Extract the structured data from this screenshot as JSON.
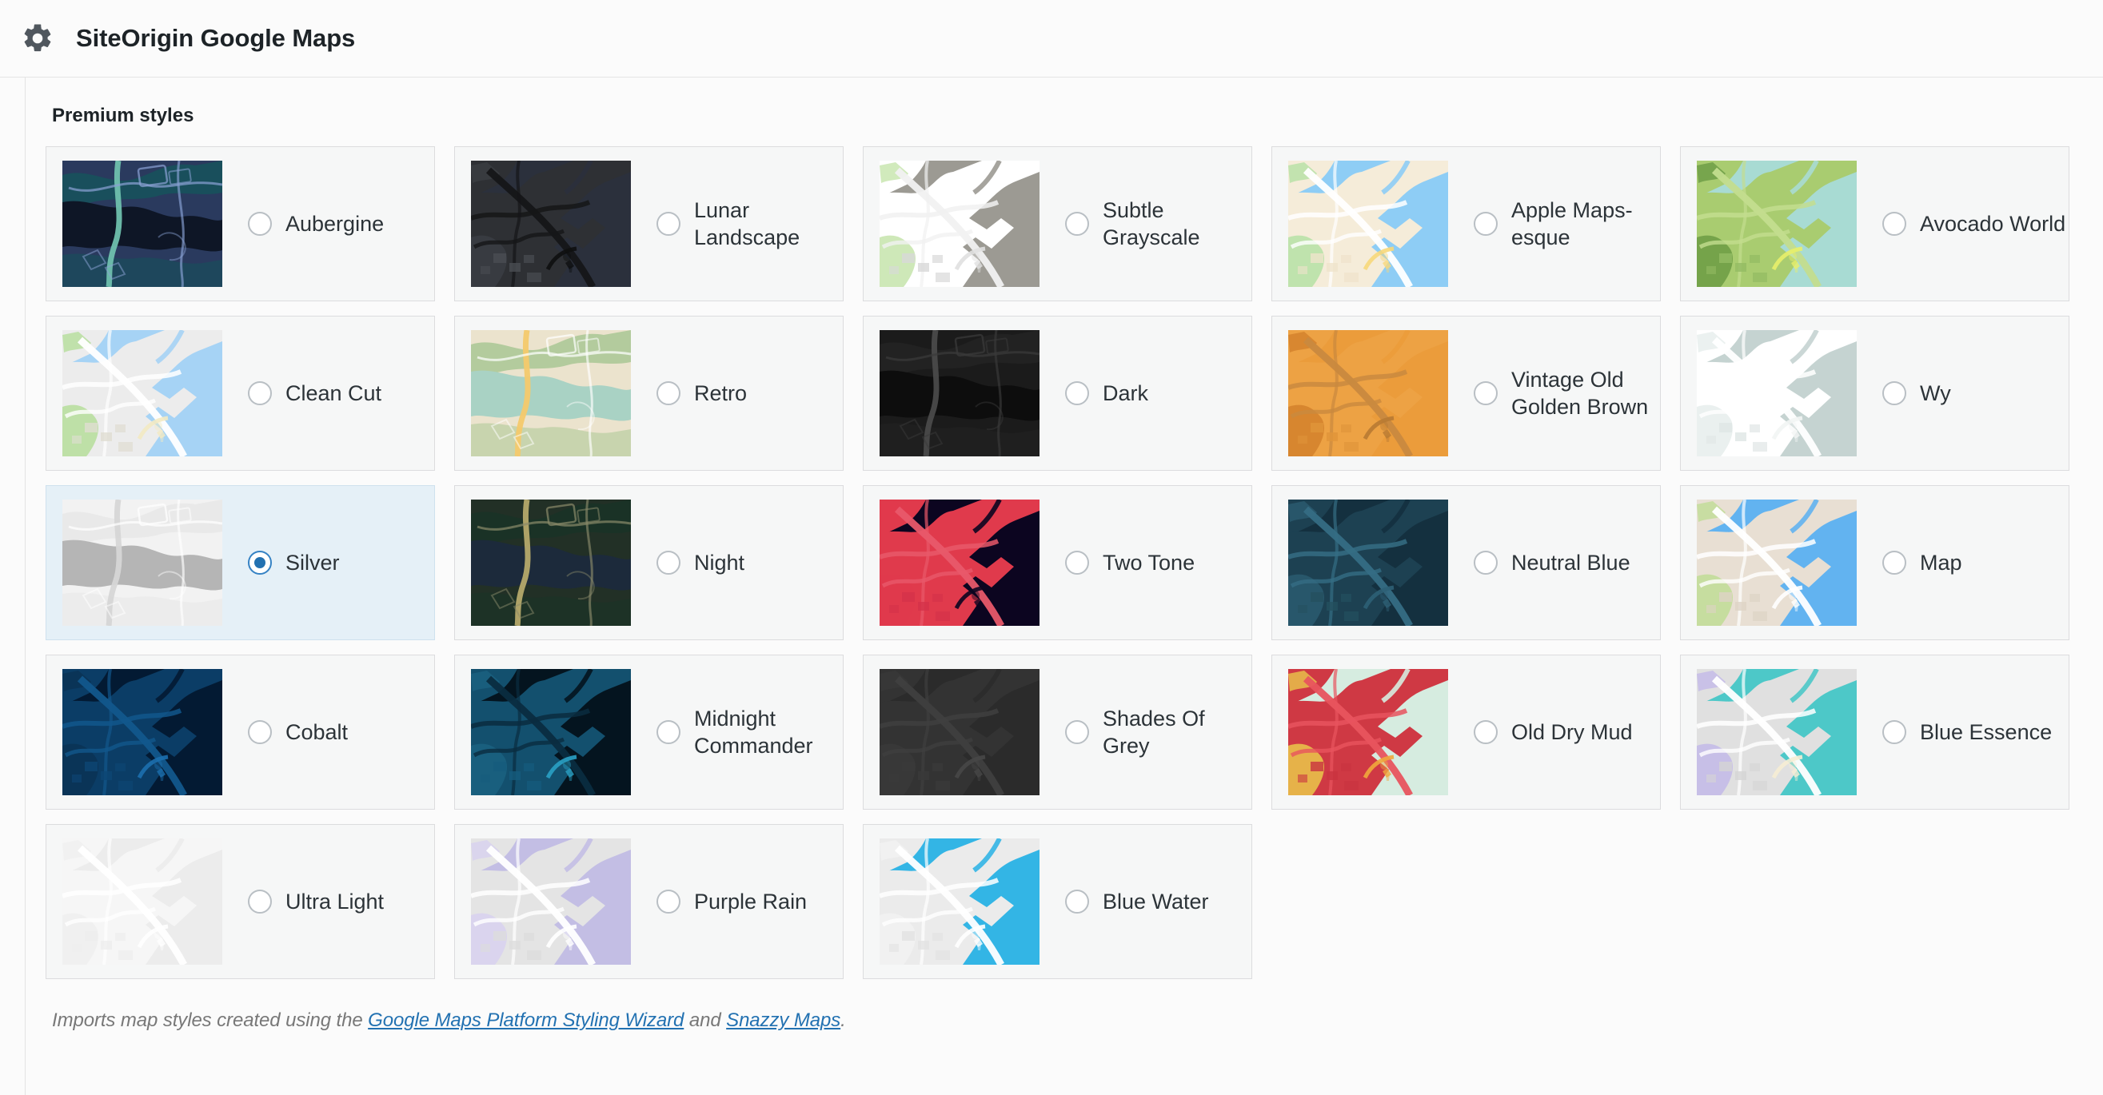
{
  "header": {
    "icon": "gear-icon",
    "title": "SiteOrigin Google Maps"
  },
  "section": {
    "title": "Premium styles"
  },
  "footer": {
    "text_before": "Imports map styles created using the ",
    "link1": "Google Maps Platform Styling Wizard",
    "text_middle": " and ",
    "link2": "Snazzy Maps",
    "text_after": ".",
    "link_color": "#2271b1"
  },
  "selection": {
    "selected_style": "Silver",
    "selected_accent": "#2271b1",
    "selected_card_bg": "#e5f0f7"
  },
  "styles": [
    {
      "label": "Aubergine",
      "selected": false,
      "thumb": {
        "kind": "organic",
        "water": "#0e1626",
        "land": "#2a3a5e",
        "green": "#18505c",
        "road": "#8ba3d6",
        "highway": "#6fc0ad"
      }
    },
    {
      "label": "Lunar Landscape",
      "selected": false,
      "thumb": {
        "kind": "city",
        "water": "#2b303c",
        "land": "#2e3034",
        "green": "#3a3d42",
        "road": "#151618",
        "highway": "#0e0f10",
        "building": "#4a4d52"
      }
    },
    {
      "label": "Subtle Grayscale",
      "selected": false,
      "thumb": {
        "kind": "city",
        "water": "#9c9a93",
        "land": "#ffffff",
        "green": "#c9e6b0",
        "road": "#f1f1f1",
        "highway": "#e0e0e0",
        "building": "#d8d8d8"
      }
    },
    {
      "label": "Apple Maps-esque",
      "selected": false,
      "thumb": {
        "kind": "city",
        "water": "#8ecdf5",
        "land": "#f5ecd9",
        "green": "#b9e2a7",
        "road": "#ffffff",
        "highway": "#f7d87a",
        "building": "#efe3cb"
      }
    },
    {
      "label": "Avocado World",
      "selected": false,
      "thumb": {
        "kind": "city",
        "water": "#a8dbd3",
        "land": "#a9cc70",
        "green": "#6f9e46",
        "road": "#c3dd8e",
        "highway": "#e8ef6a",
        "building": "#93bb63"
      }
    },
    {
      "label": "Clean Cut",
      "selected": false,
      "thumb": {
        "kind": "city",
        "water": "#a6d3f5",
        "land": "#ececec",
        "green": "#b9dfa0",
        "road": "#ffffff",
        "highway": "#f3eac3",
        "building": "#e0ddd2"
      }
    },
    {
      "label": "Retro",
      "selected": false,
      "thumb": {
        "kind": "organic",
        "water": "#a9d2c4",
        "land": "#ebe3cd",
        "green": "#b0c99a",
        "road": "#ffffff",
        "highway": "#f4c96b"
      }
    },
    {
      "label": "Dark",
      "selected": false,
      "thumb": {
        "kind": "organic",
        "water": "#0d0d0d",
        "land": "#1b1b1b",
        "green": "#232323",
        "road": "#3a3a3a",
        "highway": "#4a4a4a"
      }
    },
    {
      "label": "Vintage Old Golden Brown",
      "selected": false,
      "thumb": {
        "kind": "city",
        "water": "#eb9c3b",
        "land": "#eda244",
        "green": "#d4832d",
        "road": "#c9893f",
        "highway": "#b87a33",
        "building": "#e0953a"
      }
    },
    {
      "label": "Wy",
      "selected": false,
      "thumb": {
        "kind": "city",
        "water": "#c5d3d1",
        "land": "#ffffff",
        "green": "#e8eeed",
        "road": "#ffffff",
        "highway": "#f2f5f4",
        "building": "#dfe6e5"
      }
    },
    {
      "label": "Silver",
      "selected": true,
      "thumb": {
        "kind": "organic",
        "water": "#b5b5b5",
        "land": "#f2f2f2",
        "green": "#e8e8e8",
        "road": "#ffffff",
        "highway": "#d6d6d6"
      }
    },
    {
      "label": "Night",
      "selected": false,
      "thumb": {
        "kind": "organic",
        "water": "#1c2a3b",
        "land": "#223026",
        "green": "#1a3326",
        "road": "#8a8a6a",
        "highway": "#b5a96a"
      }
    },
    {
      "label": "Two Tone",
      "selected": false,
      "thumb": {
        "kind": "city",
        "water": "#0c0520",
        "land": "#e03a4c",
        "green": "#e03a4c",
        "road": "#e8596a",
        "highway": "#0c0520",
        "building": "#d4324a"
      }
    },
    {
      "label": "Neutral Blue",
      "selected": false,
      "thumb": {
        "kind": "city",
        "water": "#14303f",
        "land": "#1d4152",
        "green": "#2a5a6e",
        "road": "#356d84",
        "highway": "#2e6075",
        "building": "#24505f"
      }
    },
    {
      "label": "Map",
      "selected": false,
      "thumb": {
        "kind": "city",
        "water": "#62b3f0",
        "land": "#e8dfd3",
        "green": "#c2dd99",
        "road": "#ffffff",
        "highway": "#ffffff",
        "building": "#ddd3c5"
      }
    },
    {
      "label": "Cobalt",
      "selected": false,
      "thumb": {
        "kind": "city",
        "water": "#031a33",
        "land": "#0b3d66",
        "green": "#0a3355",
        "road": "#12578c",
        "highway": "#1c6fae",
        "building": "#0d4674"
      }
    },
    {
      "label": "Midnight Commander",
      "selected": false,
      "thumb": {
        "kind": "city",
        "water": "#04141f",
        "land": "#13506e",
        "green": "#1b6080",
        "road": "#0a2c40",
        "highway": "#2aa0c4",
        "building": "#155b7d"
      }
    },
    {
      "label": "Shades Of Grey",
      "selected": false,
      "thumb": {
        "kind": "city",
        "water": "#2b2b2b",
        "land": "#333333",
        "green": "#383838",
        "road": "#3f3f3f",
        "highway": "#474747",
        "building": "#3a3a3a"
      }
    },
    {
      "label": "Old Dry Mud",
      "selected": false,
      "thumb": {
        "kind": "city",
        "water": "#d6ece0",
        "land": "#cf3944",
        "green": "#e8c04a",
        "road": "#e8545e",
        "highway": "#f0a93c",
        "building": "#c93340"
      }
    },
    {
      "label": "Blue Essence",
      "selected": false,
      "thumb": {
        "kind": "city",
        "water": "#4dc8c8",
        "land": "#e0e0e0",
        "green": "#c4bbe8",
        "road": "#ffffff",
        "highway": "#f6edd4",
        "building": "#d5d5d5"
      }
    },
    {
      "label": "Ultra Light",
      "selected": false,
      "thumb": {
        "kind": "city",
        "water": "#ececec",
        "land": "#f6f6f6",
        "green": "#f0f0f0",
        "road": "#ffffff",
        "highway": "#ffffff",
        "building": "#eeeeee"
      }
    },
    {
      "label": "Purple Rain",
      "selected": false,
      "thumb": {
        "kind": "city",
        "water": "#c3bee4",
        "land": "#e4e4e4",
        "green": "#d8d2ee",
        "road": "#ffffff",
        "highway": "#ffffff",
        "building": "#dcdcdc"
      }
    },
    {
      "label": "Blue Water",
      "selected": false,
      "thumb": {
        "kind": "city",
        "water": "#33b5e5",
        "land": "#ebebeb",
        "green": "#f2f2f2",
        "road": "#ffffff",
        "highway": "#ffffff",
        "building": "#e2e2e2"
      }
    }
  ]
}
